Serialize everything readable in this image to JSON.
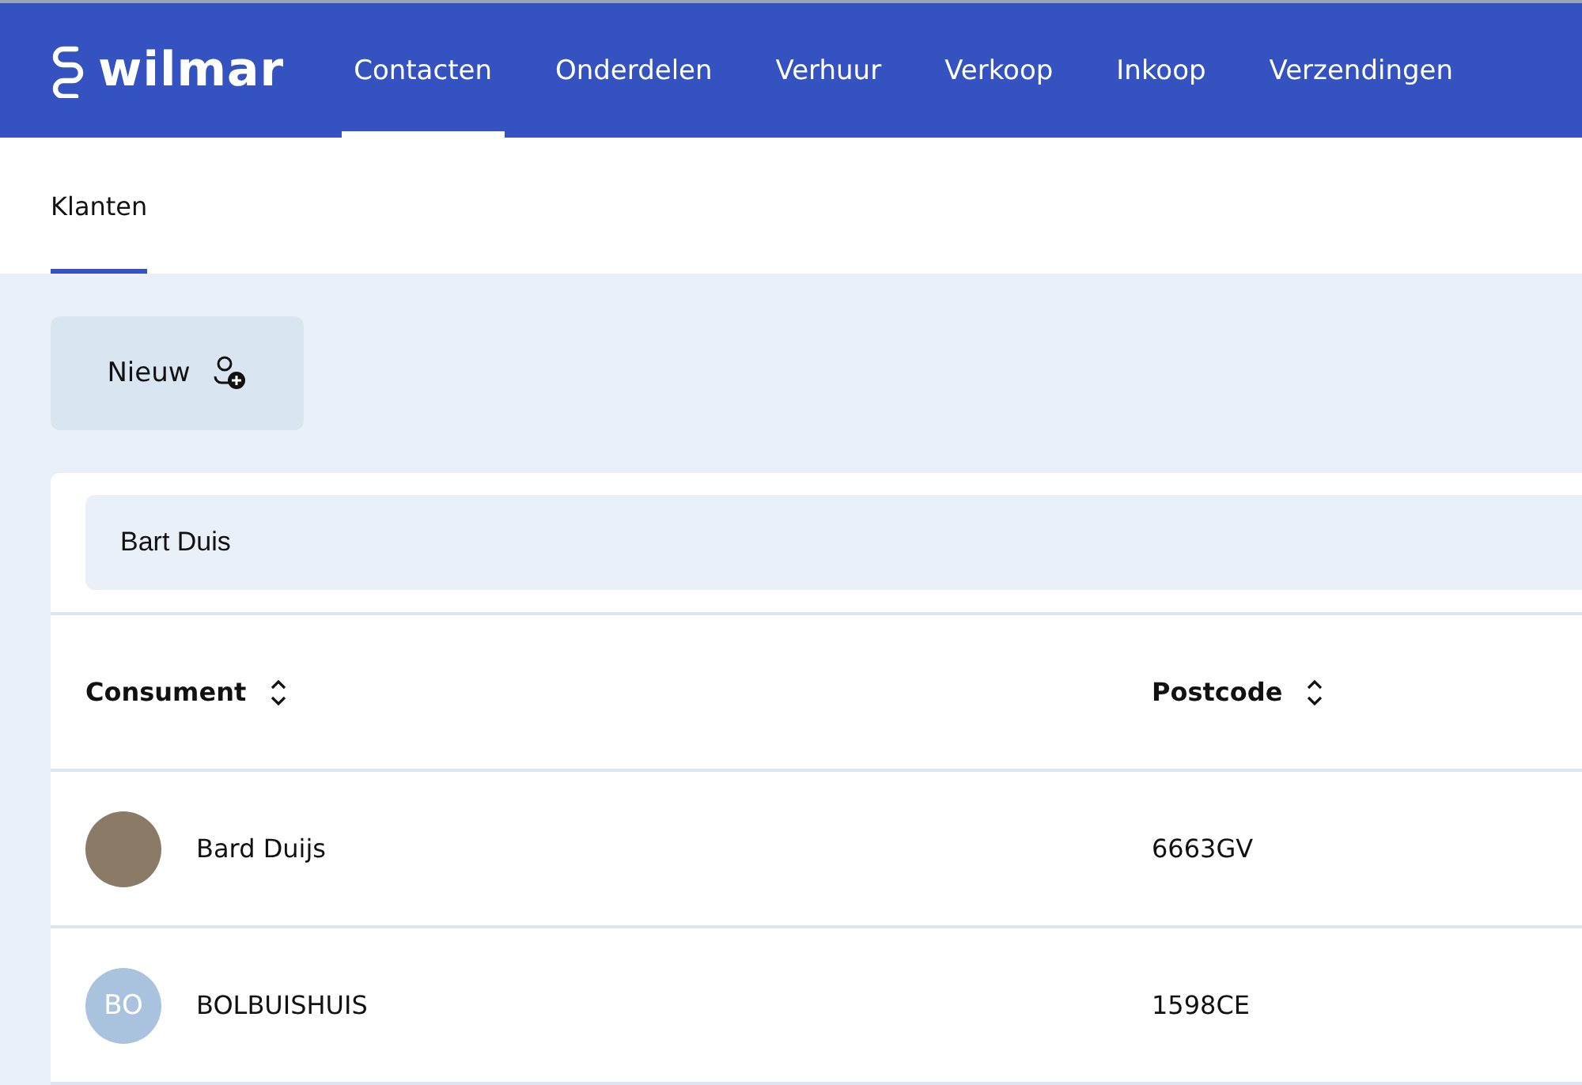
{
  "header": {
    "logo_text": "wilmar",
    "nav": [
      {
        "label": "Contacten",
        "selected": true
      },
      {
        "label": "Onderdelen",
        "selected": false
      },
      {
        "label": "Verhuur",
        "selected": false
      },
      {
        "label": "Verkoop",
        "selected": false
      },
      {
        "label": "Inkoop",
        "selected": false
      },
      {
        "label": "Verzendingen",
        "selected": false
      }
    ]
  },
  "subtabs": [
    {
      "label": "Klanten",
      "selected": true
    }
  ],
  "new_button": {
    "label": "Nieuw"
  },
  "search": {
    "value": "Bart Duis"
  },
  "table": {
    "columns": [
      "Consument",
      "Postcode"
    ],
    "rows": [
      {
        "avatar": {
          "kind": "photo"
        },
        "name": "Bard Duijs",
        "postcode": "6663GV"
      },
      {
        "avatar": {
          "kind": "initials",
          "text": "BO"
        },
        "name": "BOLBUISHUIS",
        "postcode": "1598CE"
      }
    ]
  }
}
